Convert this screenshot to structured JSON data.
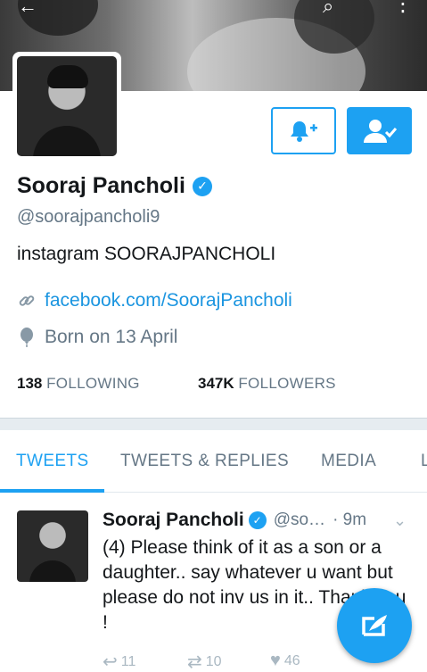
{
  "profile": {
    "name": "Sooraj Pancholi",
    "handle": "@soorajpancholi9",
    "bio": "instagram SOORAJPANCHOLI",
    "link": "facebook.com/SoorajPancholi",
    "birthday": "Born on 13 April",
    "following_count": "138",
    "following_label": "FOLLOWING",
    "followers_count": "347K",
    "followers_label": "FOLLOWERS"
  },
  "tabs": [
    {
      "label": "TWEETS",
      "active": true
    },
    {
      "label": "TWEETS & REPLIES",
      "active": false
    },
    {
      "label": "MEDIA",
      "active": false
    },
    {
      "label": "L",
      "active": false
    }
  ],
  "tweet": {
    "name": "Sooraj Pancholi",
    "handle": "@so…",
    "time": "· 9m",
    "text": "(4) Please think of it as a son or a daughter.. say whatever u want but please do not inv us in it.. Thank you !",
    "reply_count": "11",
    "retweet_count": "10",
    "like_count": "46"
  },
  "colors": {
    "accent": "#1da1f2",
    "link": "#1b95e0",
    "secondary_text": "#657786"
  },
  "icons": {
    "back": "arrow-left-icon",
    "search": "search-icon",
    "more": "more-vertical-icon",
    "notify": "bell-plus-icon",
    "following": "user-check-icon",
    "link": "link-icon",
    "birthday": "balloon-icon",
    "verified": "verified-badge-icon",
    "reply": "reply-icon",
    "retweet": "retweet-icon",
    "like": "heart-icon",
    "compose": "compose-tweet-icon"
  }
}
